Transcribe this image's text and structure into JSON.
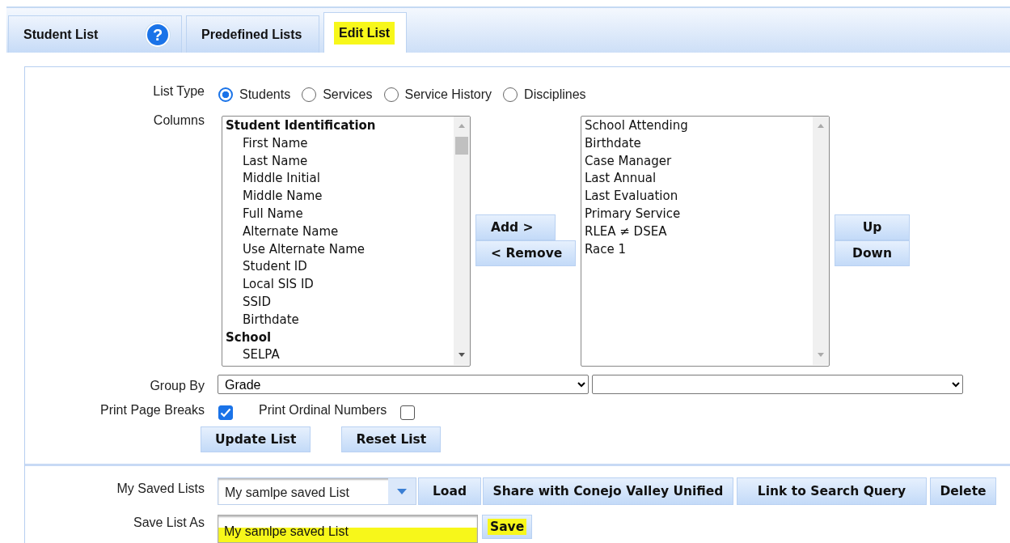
{
  "tabs": [
    {
      "label": "Student List",
      "selected": false,
      "highlighted": false,
      "help_icon": "?"
    },
    {
      "label": "Predefined Lists",
      "selected": false,
      "highlighted": false
    },
    {
      "label": "Edit List",
      "selected": true,
      "highlighted": true
    }
  ],
  "list_type": {
    "label": "List Type",
    "options": [
      {
        "label": "Students",
        "selected": true
      },
      {
        "label": "Services",
        "selected": false
      },
      {
        "label": "Service History",
        "selected": false
      },
      {
        "label": "Disciplines",
        "selected": false
      }
    ]
  },
  "columns": {
    "label": "Columns",
    "available": [
      {
        "label": "Student Identification",
        "children": [
          {
            "label": "First Name"
          },
          {
            "label": "Last Name"
          },
          {
            "label": "Middle Initial"
          },
          {
            "label": "Middle Name"
          },
          {
            "label": "Full Name"
          },
          {
            "label": "Alternate Name"
          },
          {
            "label": "Use Alternate Name"
          },
          {
            "label": "Student ID"
          },
          {
            "label": "Local SIS ID"
          },
          {
            "label": "SSID"
          },
          {
            "label": "Birthdate"
          }
        ]
      },
      {
        "label": "School",
        "children": [
          {
            "label": "SELPA"
          }
        ]
      }
    ],
    "move_buttons": [
      "Add >",
      "< Remove"
    ],
    "chosen": [
      "School Attending",
      "Birthdate",
      "Case Manager",
      "Last Annual",
      "Last Evaluation",
      "Primary Service",
      "RLEA ≠ DSEA",
      "Race 1"
    ],
    "order_buttons": [
      "Up",
      "Down"
    ]
  },
  "group_by": {
    "label": "Group By",
    "value": "Grade"
  },
  "print_page_breaks": {
    "label": "Print Page Breaks",
    "checked": true
  },
  "print_ordinal_numbers": {
    "label": "Print Ordinal Numbers",
    "checked": false
  },
  "list_buttons": [
    "Update List",
    "Reset List"
  ],
  "my_saved_lists": {
    "label": "My Saved Lists",
    "value": "My samlpe saved List",
    "buttons": [
      {
        "label": "Load"
      },
      {
        "label": "Share with Conejo Valley Unified"
      },
      {
        "label": "Link to Search Query"
      },
      {
        "label": "Delete"
      }
    ]
  },
  "save_list_as": {
    "label": "Save List As",
    "value": "My samlpe saved List",
    "highlighted": true,
    "button": {
      "label": "Save",
      "highlighted": true
    }
  }
}
